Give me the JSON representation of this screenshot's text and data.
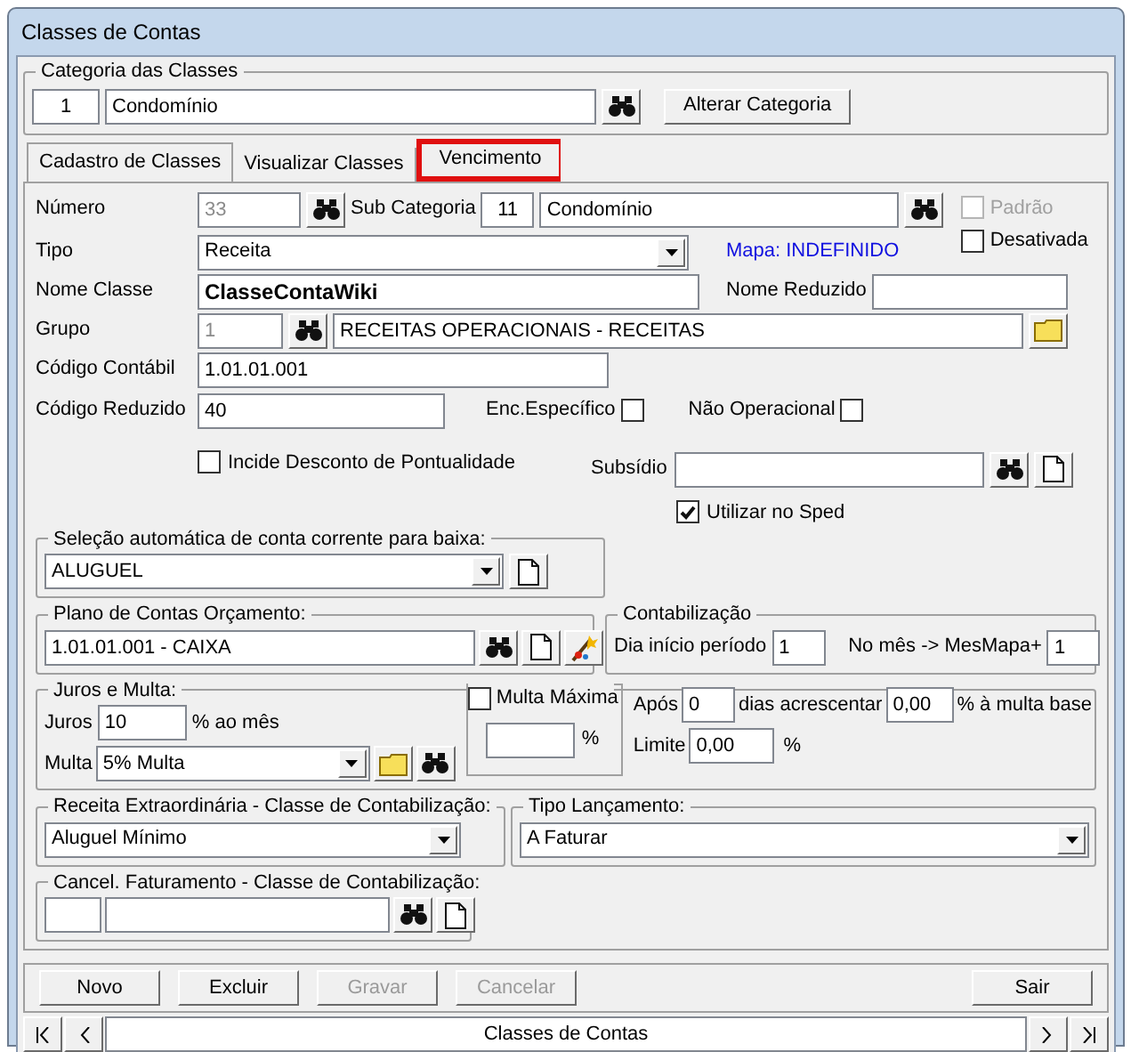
{
  "window": {
    "title": "Classes de Contas"
  },
  "categoria": {
    "legend": "Categoria das Classes",
    "code": "1",
    "name": "Condomínio",
    "button": "Alterar Categoria"
  },
  "tabs": [
    {
      "label": "Cadastro de Classes",
      "selected": true,
      "highlighted": false
    },
    {
      "label": "Visualizar Classes",
      "selected": false,
      "highlighted": false
    },
    {
      "label": "Vencimento",
      "selected": false,
      "highlighted": true
    }
  ],
  "form": {
    "numero": {
      "label": "Número",
      "value": "33",
      "disabled": true
    },
    "sub_categoria": {
      "label": "Sub Categoria",
      "code": "11",
      "name": "Condomínio"
    },
    "padrao": {
      "label": "Padrão",
      "checked": false,
      "disabled": true
    },
    "desativada": {
      "label": "Desativada",
      "checked": false,
      "disabled": false
    },
    "tipo": {
      "label": "Tipo",
      "value": "Receita"
    },
    "mapa": "Mapa: INDEFINIDO",
    "nome_classe": {
      "label": "Nome Classe",
      "value": "ClasseContaWiki"
    },
    "nome_reduzido": {
      "label": "Nome Reduzido"
    },
    "grupo": {
      "label": "Grupo",
      "code": "1",
      "name": "RECEITAS OPERACIONAIS - RECEITAS"
    },
    "codigo_contabil": {
      "label": "Código Contábil",
      "value": "1.01.01.001"
    },
    "codigo_reduzido": {
      "label": "Código Reduzido",
      "value": "40"
    },
    "enc_especifico": {
      "label": "Enc.Específico",
      "checked": false
    },
    "nao_operacional": {
      "label": "Não Operacional",
      "checked": false
    },
    "incide_desconto": {
      "label": "Incide Desconto de Pontualidade",
      "checked": false
    },
    "subsidio": {
      "label": "Subsídio"
    },
    "utilizar_sped": {
      "label": "Utilizar no Sped",
      "checked": true
    }
  },
  "selecao": {
    "legend": "Seleção automática de conta corrente para baixa:",
    "value": "ALUGUEL"
  },
  "plano": {
    "legend": "Plano de Contas Orçamento:",
    "value": "1.01.01.001 - CAIXA"
  },
  "contabilizacao": {
    "legend": "Contabilização",
    "dia_label": "Dia início período",
    "dia_value": "1",
    "mes_label": "No mês -> MesMapa+",
    "mes_value": "1"
  },
  "juros_multa": {
    "legend": "Juros e Multa:",
    "juros_label": "Juros",
    "juros_value": "10",
    "juros_unit": "% ao mês",
    "multa_label": "Multa",
    "multa_value": "5% Multa",
    "multa_maxima_label": "Multa Máxima",
    "multa_maxima_checked": false,
    "multa_maxima_unit": "%",
    "apos_label": "Após",
    "apos_value": "0",
    "dias_label": "dias acrescentar",
    "acrescentar_value": "0,00",
    "base_label": "% à multa base",
    "limite_label": "Limite",
    "limite_value": "0,00",
    "limite_unit": "%"
  },
  "receita_extra": {
    "legend": "Receita Extraordinária - Classe de Contabilização:",
    "value": "Aluguel Mínimo"
  },
  "tipo_lancamento": {
    "legend": "Tipo Lançamento:",
    "value": "A Faturar"
  },
  "cancel": {
    "legend": "Cancel. Faturamento - Classe de Contabilização:"
  },
  "buttons": [
    {
      "label": "Novo",
      "disabled": false
    },
    {
      "label": "Excluir",
      "disabled": false
    },
    {
      "label": "Gravar",
      "disabled": true
    },
    {
      "label": "Cancelar",
      "disabled": true
    },
    {
      "label": "Sair",
      "disabled": false
    }
  ],
  "navigator": {
    "title": "Classes de Contas"
  }
}
